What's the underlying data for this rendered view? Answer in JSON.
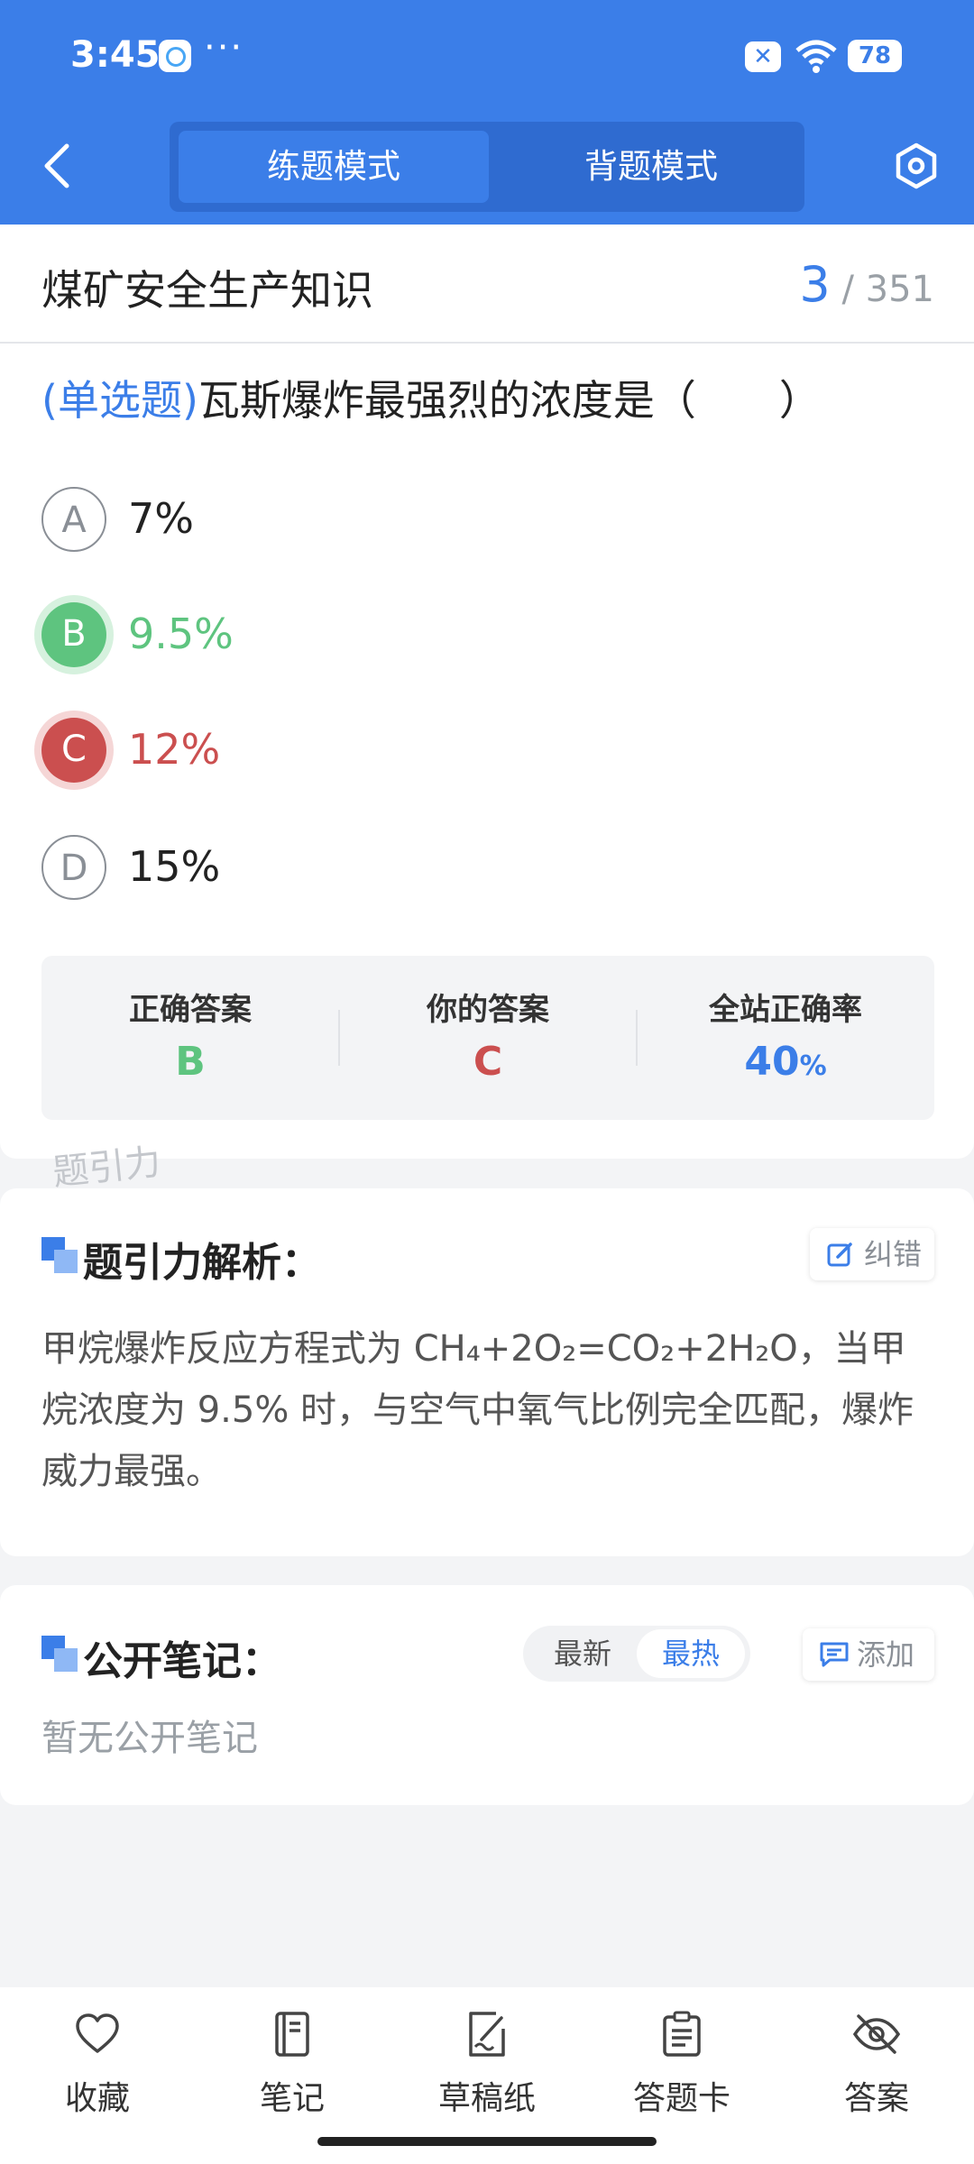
{
  "status_bar": {
    "time": "3:45",
    "battery": "78"
  },
  "header": {
    "tabs": [
      {
        "label": "练题模式",
        "active": true
      },
      {
        "label": "背题模式",
        "active": false
      }
    ]
  },
  "subject": {
    "title": "煤矿安全生产知识",
    "current": "3",
    "total": "/ 351"
  },
  "question": {
    "type": "(单选题)",
    "text": "瓦斯爆炸最强烈的浓度是（　　）",
    "options": [
      {
        "letter": "A",
        "text": "7%",
        "state": "normal"
      },
      {
        "letter": "B",
        "text": "9.5%",
        "state": "correct"
      },
      {
        "letter": "C",
        "text": "12%",
        "state": "wrong"
      },
      {
        "letter": "D",
        "text": "15%",
        "state": "normal"
      }
    ]
  },
  "summary": {
    "correct_label": "正确答案",
    "correct_value": "B",
    "yours_label": "你的答案",
    "yours_value": "C",
    "rate_label": "全站正确率",
    "rate_value": "40",
    "rate_unit": "%"
  },
  "watermark": "题引力",
  "analysis": {
    "title": "题引力解析：",
    "report_label": "纠错",
    "body": "甲烷爆炸反应方程式为 CH₄+2O₂=CO₂+2H₂O，当甲烷浓度为 9.5% 时，与空气中氧气比例完全匹配，爆炸威力最强。"
  },
  "notes": {
    "title": "公开笔记：",
    "sort_newest": "最新",
    "sort_hottest": "最热",
    "add_label": "添加",
    "empty_text": "暂无公开笔记"
  },
  "bottom_nav": [
    {
      "label": "收藏",
      "icon": "heart-icon"
    },
    {
      "label": "笔记",
      "icon": "notebook-icon"
    },
    {
      "label": "草稿纸",
      "icon": "draft-paper-icon"
    },
    {
      "label": "答题卡",
      "icon": "answer-sheet-icon"
    },
    {
      "label": "答案",
      "icon": "eye-off-icon"
    }
  ],
  "colors": {
    "primary": "#3b7ee8",
    "correct": "#5ec47f",
    "wrong": "#cb4f4f"
  }
}
